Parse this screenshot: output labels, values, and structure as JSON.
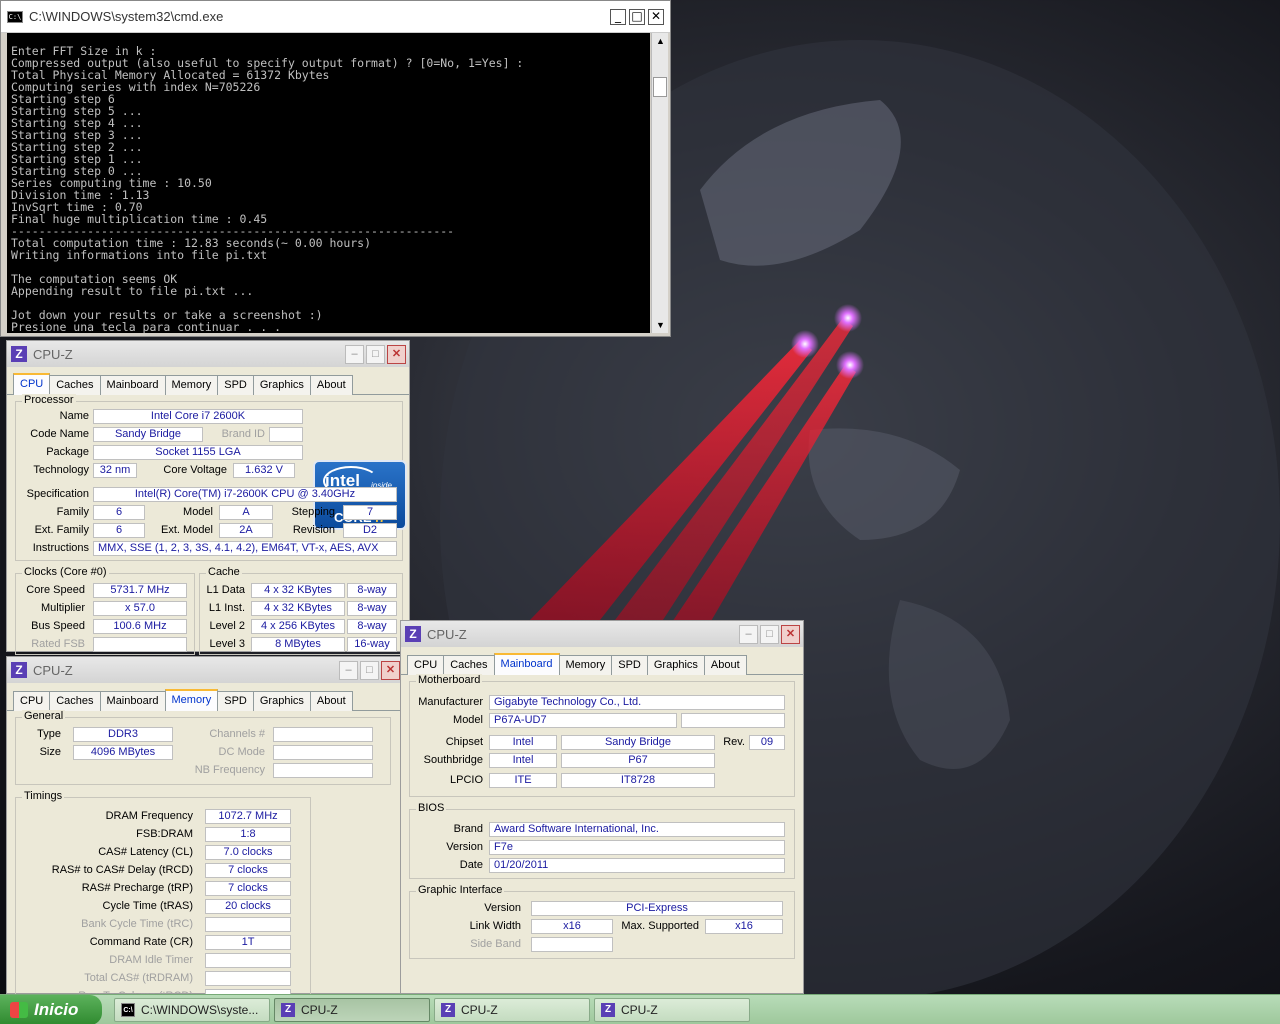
{
  "cmd": {
    "title": "C:\\WINDOWS\\system32\\cmd.exe",
    "lines": [
      "Enter FFT Size in k :",
      "Compressed output (also useful to specify output format) ? [0=No, 1=Yes] :",
      "Total Physical Memory Allocated = 61372 Kbytes",
      "Computing series with index N=705226",
      "Starting step 6",
      "Starting step 5 ...",
      "Starting step 4 ...",
      "Starting step 3 ...",
      "Starting step 2 ...",
      "Starting step 1 ...",
      "Starting step 0 ...",
      "Series computing time : 10.50",
      "Division time : 1.13",
      "InvSqrt time : 0.70",
      "Final huge multiplication time : 0.45",
      "----------------------------------------------------------------",
      "Total computation time : 12.83 seconds(~ 0.00 hours)",
      "Writing informations into file pi.txt",
      "",
      "The computation seems OK",
      "Appending result to file pi.txt ...",
      "",
      "Jot down your results or take a screenshot :)",
      "Presione una tecla para continuar . . ."
    ]
  },
  "tabs": [
    "CPU",
    "Caches",
    "Mainboard",
    "Memory",
    "SPD",
    "Graphics",
    "About"
  ],
  "cpuz_cpu": {
    "title": "CPU-Z",
    "processor_label": "Processor",
    "name_label": "Name",
    "name": "Intel Core i7 2600K",
    "codename_label": "Code Name",
    "codename": "Sandy Bridge",
    "brandid_label": "Brand ID",
    "package_label": "Package",
    "package": "Socket 1155 LGA",
    "technology_label": "Technology",
    "technology": "32 nm",
    "voltage_label": "Core Voltage",
    "voltage": "1.632 V",
    "spec_label": "Specification",
    "spec": "Intel(R) Core(TM) i7-2600K CPU @ 3.40GHz",
    "family_label": "Family",
    "family": "6",
    "model_label": "Model",
    "model": "A",
    "stepping_label": "Stepping",
    "stepping": "7",
    "extfamily_label": "Ext. Family",
    "extfamily": "6",
    "extmodel_label": "Ext. Model",
    "extmodel": "2A",
    "revision_label": "Revision",
    "revision": "D2",
    "instructions_label": "Instructions",
    "instructions": "MMX, SSE (1, 2, 3, 3S, 4.1, 4.2), EM64T, VT-x, AES, AVX",
    "clocks_label": "Clocks (Core #0)",
    "corespeed_label": "Core Speed",
    "corespeed": "5731.7 MHz",
    "multiplier_label": "Multiplier",
    "multiplier": "x 57.0",
    "busspeed_label": "Bus Speed",
    "busspeed": "100.6 MHz",
    "ratedfsb_label": "Rated FSB",
    "cache_label": "Cache",
    "l1d_label": "L1 Data",
    "l1d": "4 x 32 KBytes",
    "l1d_way": "8-way",
    "l1i_label": "L1 Inst.",
    "l1i": "4 x 32 KBytes",
    "l1i_way": "8-way",
    "l2_label": "Level 2",
    "l2": "4 x 256 KBytes",
    "l2_way": "8-way",
    "l3_label": "Level 3",
    "l3": "8 MBytes",
    "l3_way": "16-way",
    "logo": {
      "brand": "intel",
      "inside": "inside",
      "core": "CORE",
      "tier": "i7"
    }
  },
  "cpuz_mem": {
    "title": "CPU-Z",
    "general_label": "General",
    "type_label": "Type",
    "type": "DDR3",
    "size_label": "Size",
    "size": "4096 MBytes",
    "channels_label": "Channels #",
    "dcmode_label": "DC Mode",
    "nbfreq_label": "NB Frequency",
    "timings_label": "Timings",
    "dramfreq_label": "DRAM Frequency",
    "dramfreq": "1072.7 MHz",
    "fsbdram_label": "FSB:DRAM",
    "fsbdram": "1:8",
    "cl_label": "CAS# Latency (CL)",
    "cl": "7.0 clocks",
    "trcd_label": "RAS# to CAS# Delay (tRCD)",
    "trcd": "7 clocks",
    "trp_label": "RAS# Precharge (tRP)",
    "trp": "7 clocks",
    "tras_label": "Cycle Time (tRAS)",
    "tras": "20 clocks",
    "trc_label": "Bank Cycle Time (tRC)",
    "cr_label": "Command Rate (CR)",
    "cr": "1T",
    "idle_label": "DRAM Idle Timer",
    "trdram_label": "Total CAS# (tRDRAM)",
    "trcd2_label": "Row To Column (tRCD)"
  },
  "cpuz_mb": {
    "title": "CPU-Z",
    "motherboard_label": "Motherboard",
    "manufacturer_label": "Manufacturer",
    "manufacturer": "Gigabyte Technology Co., Ltd.",
    "model_label": "Model",
    "model": "P67A-UD7",
    "chipset_label": "Chipset",
    "chipset_vendor": "Intel",
    "chipset": "Sandy Bridge",
    "rev_label": "Rev.",
    "rev": "09",
    "southbridge_label": "Southbridge",
    "sb_vendor": "Intel",
    "sb": "P67",
    "lpcio_label": "LPCIO",
    "lpcio_vendor": "ITE",
    "lpcio": "IT8728",
    "bios_label": "BIOS",
    "brand_label": "Brand",
    "brand": "Award Software International, Inc.",
    "version_label": "Version",
    "version": "F7e",
    "date_label": "Date",
    "date": "01/20/2011",
    "gi_label": "Graphic Interface",
    "giversion_label": "Version",
    "giversion": "PCI-Express",
    "linkwidth_label": "Link Width",
    "linkwidth": "x16",
    "maxsup_label": "Max. Supported",
    "maxsup": "x16",
    "sideband_label": "Side Band"
  },
  "taskbar": {
    "start": "Inicio",
    "items": [
      "C:\\WINDOWS\\syste...",
      "CPU-Z",
      "CPU-Z",
      "CPU-Z"
    ]
  }
}
